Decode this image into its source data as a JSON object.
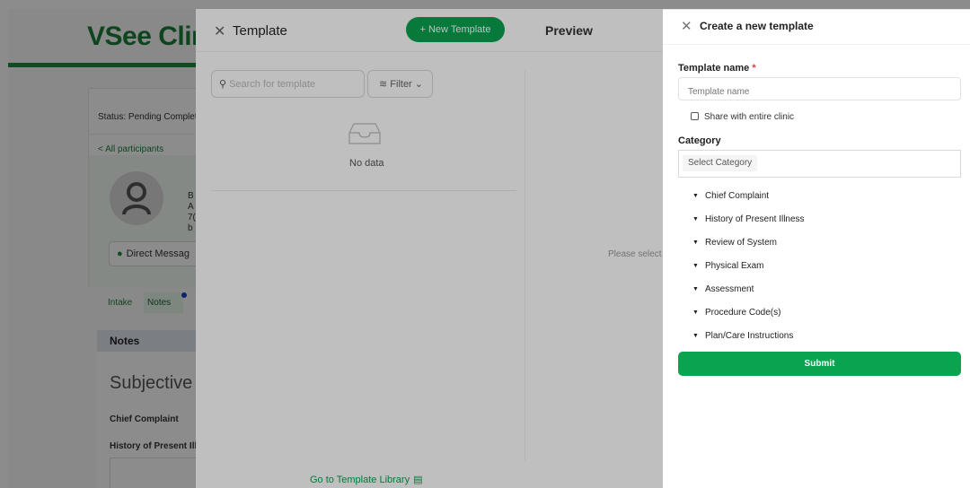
{
  "background": {
    "logo": "VSee Clin",
    "status": "Status: Pending Complet",
    "back_link": "< All participants",
    "patient_lines": [
      "B",
      "A",
      "7(",
      "b"
    ],
    "direct_message": "Direct Messag",
    "tabs": {
      "intake": "Intake",
      "notes": "Notes"
    },
    "notes_header": "Notes",
    "subjective": "Subjective",
    "chief_complaint": "Chief Complaint",
    "history": "History of Present Ill"
  },
  "template_drawer": {
    "title": "Template",
    "new_template": "+ New Template",
    "preview_title": "Preview",
    "search_placeholder": "Search for template",
    "filter_label": "Filter",
    "empty_text": "No data",
    "preview_hint": "Please select",
    "library_link": "Go to Template Library"
  },
  "create_panel": {
    "title": "Create a new template",
    "name_label": "Template name",
    "name_required": "*",
    "name_placeholder": "Template name",
    "share_label": "Share with entire clinic",
    "share_checked": false,
    "category_label": "Category",
    "category_placeholder": "Select Category",
    "categories": [
      "Chief Complaint",
      "History of Present Illness",
      "Review of System",
      "Physical Exam",
      "Assessment",
      "Procedure Code(s)",
      "Plan/Care Instructions"
    ],
    "submit": "Submit"
  },
  "colors": {
    "primary_green": "#0aa34f",
    "logo_green": "#1b7f3a",
    "required_red": "#e53935"
  },
  "icons": [
    "close-icon",
    "search-icon",
    "filter-icon",
    "chevron-down-icon",
    "inbox-icon",
    "library-icon",
    "caret-down-icon",
    "chat-icon",
    "user-icon"
  ]
}
